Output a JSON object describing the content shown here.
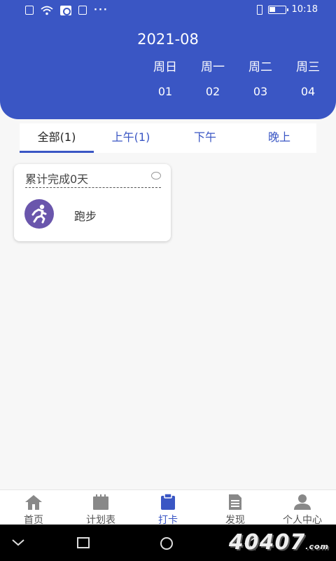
{
  "statusbar": {
    "time": "10:18",
    "dots": "···"
  },
  "header": {
    "month": "2021-08",
    "days": [
      {
        "week": "周日",
        "date": "01"
      },
      {
        "week": "周一",
        "date": "02"
      },
      {
        "week": "周二",
        "date": "03"
      },
      {
        "week": "周三",
        "date": "04"
      }
    ]
  },
  "tabs": [
    {
      "label": "全部(1)",
      "active": true
    },
    {
      "label": "上午(1)",
      "active": false
    },
    {
      "label": "下午",
      "active": false
    },
    {
      "label": "晚上",
      "active": false
    }
  ],
  "card": {
    "title": "累计完成0天",
    "activity": "跑步",
    "icon": "running-icon"
  },
  "bottomnav": [
    {
      "label": "首页",
      "icon": "home-icon"
    },
    {
      "label": "计划表",
      "icon": "calendar-icon"
    },
    {
      "label": "打卡",
      "icon": "clipboard-icon",
      "active": true
    },
    {
      "label": "发现",
      "icon": "document-icon"
    },
    {
      "label": "个人中心",
      "icon": "user-icon"
    }
  ],
  "watermark": {
    "main": "40407",
    "suffix": ".com"
  },
  "colors": {
    "primary": "#3a56c4",
    "avatar": "#6a56ac"
  }
}
